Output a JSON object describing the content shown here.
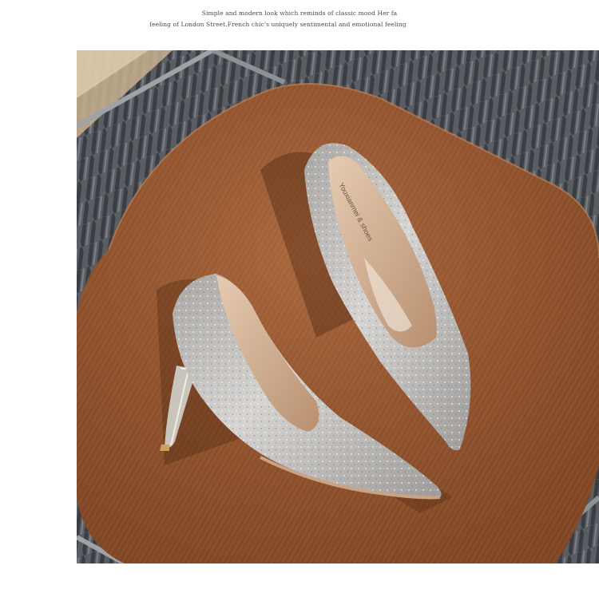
{
  "caption": {
    "line1": "Simple and modern look which reminds of classic mood  Her fa",
    "line2": "feeling of London Street.French chic's uniquely sentimental and emotional feeling"
  },
  "photo": {
    "insole_brand": "Youxianmei & shoes",
    "colors": {
      "cushion": "#9a5a33",
      "rug": "#4d5258",
      "shoe_silver": "#c6c4c2",
      "lining": "#d9b89a"
    }
  }
}
